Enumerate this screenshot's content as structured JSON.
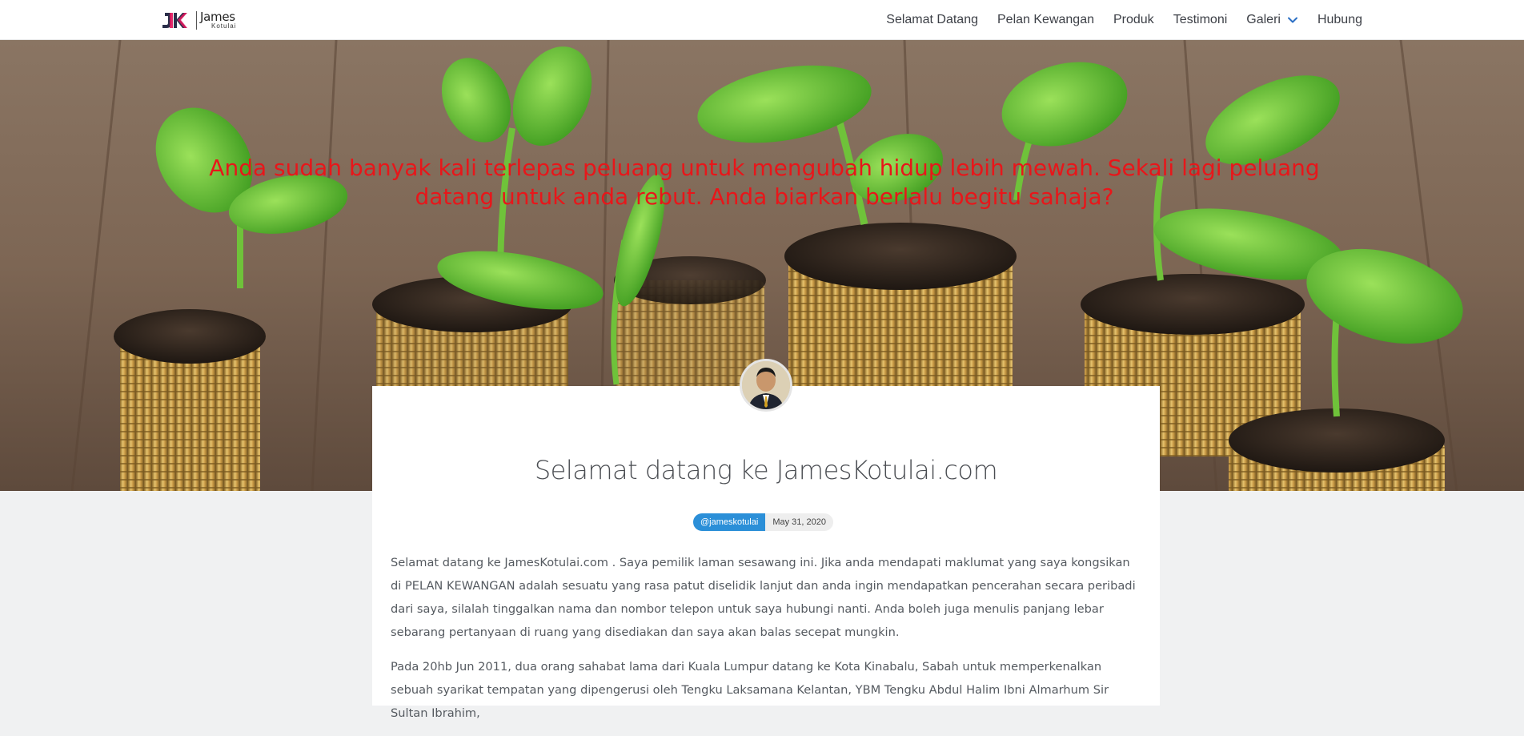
{
  "brand": {
    "line1": "James",
    "line2": "Kotulai",
    "mark_colors": [
      "#2a2f4a",
      "#e2165d"
    ]
  },
  "nav": {
    "items": [
      {
        "label": "Selamat Datang"
      },
      {
        "label": "Pelan Kewangan"
      },
      {
        "label": "Produk"
      },
      {
        "label": "Testimoni"
      },
      {
        "label": "Galeri"
      },
      {
        "label": "Hubung"
      }
    ],
    "dropdown_icon": "chevron-down-icon",
    "accent": "#2b6fc4"
  },
  "hero": {
    "headline": "Anda sudah banyak kali terlepas peluang untuk mengubah hidup lebih mewah. Sekali lagi peluang datang untuk anda rebut. Anda biarkan berlalu begitu sahaja?",
    "headline_color": "#e8161a"
  },
  "post": {
    "title": "Selamat datang ke JamesKotulai.com",
    "author": "@jameskotulai",
    "date": "May 31, 2020",
    "paragraphs": [
      "Selamat datang ke JamesKotulai.com . Saya pemilik laman sesawang ini. Jika anda mendapati maklumat yang saya kongsikan di PELAN KEWANGAN adalah sesuatu yang rasa patut diselidik lanjut dan anda ingin mendapatkan pencerahan secara peribadi dari saya, silalah tinggalkan nama dan nombor telepon untuk saya hubungi nanti. Anda boleh juga menulis panjang lebar sebarang pertanyaan di ruang yang disediakan dan saya akan balas secepat mungkin.",
      "Pada 20hb Jun 2011, dua orang sahabat lama dari Kuala Lumpur datang ke Kota Kinabalu, Sabah untuk memperkenalkan sebuah syarikat tempatan yang dipengerusi oleh Tengku Laksamana Kelantan, YBM Tengku Abdul Halim Ibni Almarhum Sir Sultan Ibrahim,"
    ]
  }
}
